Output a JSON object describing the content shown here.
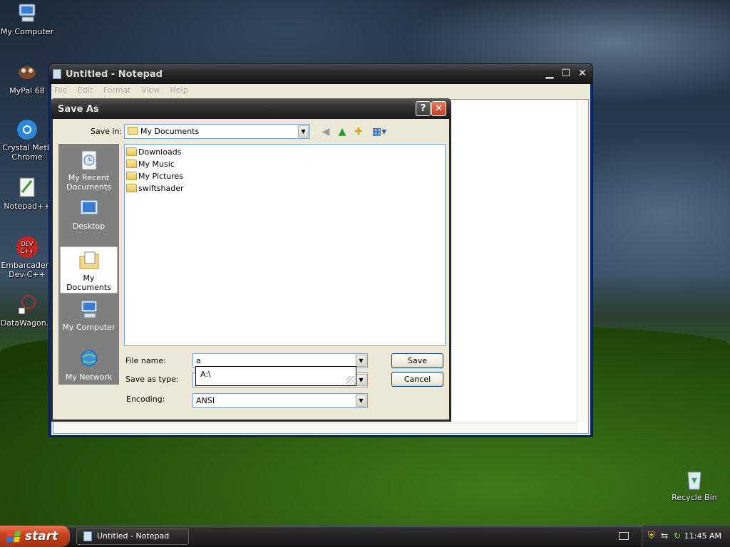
{
  "desktop": {
    "icons": [
      {
        "label": "My Computer"
      },
      {
        "label": "MyPal 68"
      },
      {
        "label": "Crystal Meth Chrome"
      },
      {
        "label": "Notepad++"
      },
      {
        "label": "Embarcadero Dev-C++"
      },
      {
        "label": "DataWagon..."
      },
      {
        "label": "Recycle Bin"
      }
    ]
  },
  "notepad": {
    "title": "Untitled - Notepad",
    "menu": [
      "File",
      "Edit",
      "Format",
      "View",
      "Help"
    ]
  },
  "dialog": {
    "title": "Save As",
    "help_label": "?",
    "close_label": "✕",
    "save_in_label": "Save in:",
    "save_in_value": "My Documents",
    "places": [
      {
        "label": "My Recent Documents"
      },
      {
        "label": "Desktop"
      },
      {
        "label": "My Documents"
      },
      {
        "label": "My Computer"
      },
      {
        "label": "My Network"
      }
    ],
    "files": [
      "Downloads",
      "My Music",
      "My Pictures",
      "swiftshader"
    ],
    "file_name_label": "File name:",
    "file_name_value": "a",
    "autocomplete": "A:\\",
    "save_as_type_label": "Save as type:",
    "encoding_label": "Encoding:",
    "encoding_value": "ANSI",
    "save_label": "Save",
    "cancel_label": "Cancel"
  },
  "taskbar": {
    "start_label": "start",
    "task_label": "Untitled - Notepad",
    "clock": "11:45 AM"
  }
}
